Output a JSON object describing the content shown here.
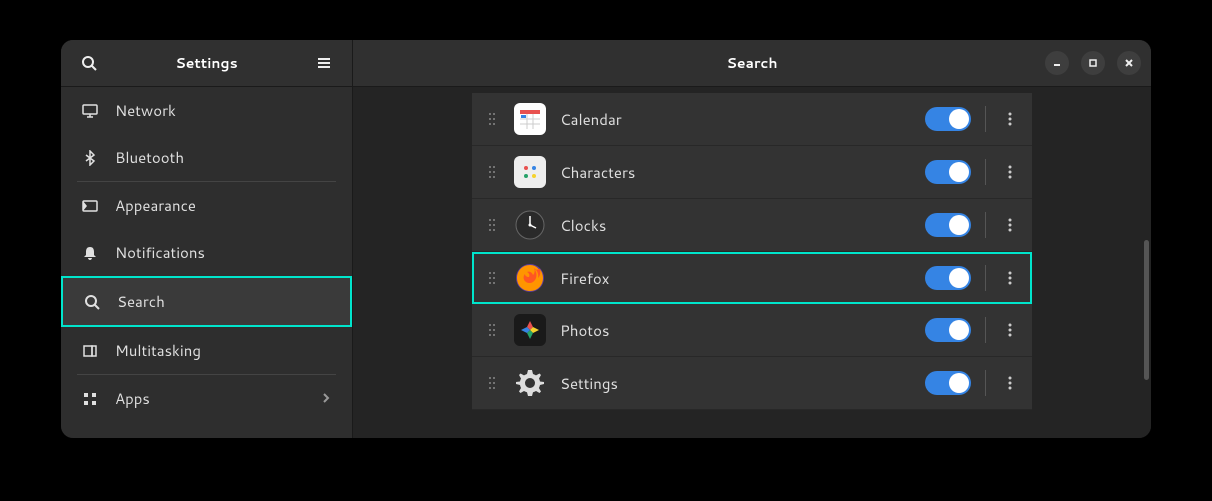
{
  "sidebar": {
    "title": "Settings",
    "items": [
      {
        "label": "Network",
        "icon": "display"
      },
      {
        "label": "Bluetooth",
        "icon": "bluetooth"
      },
      {
        "label": "Appearance",
        "icon": "appearance"
      },
      {
        "label": "Notifications",
        "icon": "bell"
      },
      {
        "label": "Search",
        "icon": "search",
        "active": true,
        "highlighted": true
      },
      {
        "label": "Multitasking",
        "icon": "multitask"
      },
      {
        "label": "Apps",
        "icon": "apps",
        "chevron": true
      }
    ]
  },
  "main": {
    "title": "Search",
    "rows": [
      {
        "label": "Calendar",
        "icon": "calendar",
        "enabled": true
      },
      {
        "label": "Characters",
        "icon": "characters",
        "enabled": true
      },
      {
        "label": "Clocks",
        "icon": "clocks",
        "enabled": true
      },
      {
        "label": "Firefox",
        "icon": "firefox",
        "enabled": true,
        "highlighted": true
      },
      {
        "label": "Photos",
        "icon": "photos",
        "enabled": true
      },
      {
        "label": "Settings",
        "icon": "settings",
        "enabled": true
      }
    ]
  }
}
